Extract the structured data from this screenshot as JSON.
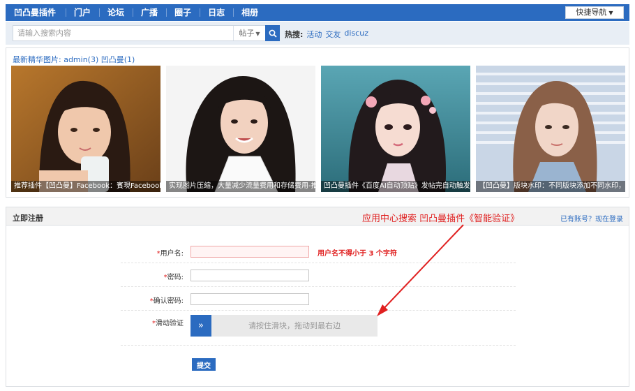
{
  "nav": {
    "brand": "凹凸曼插件",
    "items": [
      "门户",
      "论坛",
      "广播",
      "圈子",
      "日志",
      "相册"
    ],
    "quick_nav": "快捷导航"
  },
  "search": {
    "placeholder": "请输入搜索内容",
    "type": "帖子",
    "hot_label": "热搜:",
    "hot_words": [
      "活动",
      "交友",
      "discuz"
    ]
  },
  "gallery": {
    "heading": "最新精华图片: admin(3) 凹凸曼(1)",
    "photos": [
      {
        "caption": "推荐插件【凹凸曼】Facebook：賓現Facebook登鍵登",
        "icon": "photo-girl-milk"
      },
      {
        "caption": "实现图片压缩，大量减少流量费用和存储费用-推荐凹",
        "icon": "photo-girl-smile"
      },
      {
        "caption": "凹凸曼插件《百度AI自动顶贴》发帖完自动触发AI自",
        "icon": "photo-girl-flowers"
      },
      {
        "caption": "【凹凸曼】版块水印：不同版块添加不同水印，支持",
        "icon": "photo-girl-window"
      }
    ]
  },
  "register": {
    "title": "立即注册",
    "promo": "应用中心搜索 凹凸曼插件《智能验证》",
    "login_link": "已有账号？现在登录",
    "username_label": "用户名:",
    "username_error": "用户名不得小于 3 个字符",
    "password_label": "密码:",
    "confirm_label": "确认密码:",
    "captcha_label": "滑动验证",
    "slider_hint": "请按住滑块，拖动到最右边",
    "submit": "提交"
  },
  "colors": {
    "nav_bg": "#2b6bc0",
    "accent": "#2b6bc0",
    "error": "#e02020"
  }
}
